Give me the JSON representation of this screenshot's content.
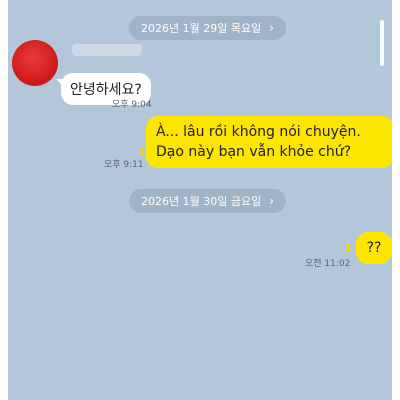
{
  "dates": {
    "first": "2026년 1월 29일 목요일",
    "second": "2026년 1월 30일 금요일",
    "chevron": "›"
  },
  "messages": [
    {
      "sender": "other",
      "text": "안녕하세요?",
      "time": "오후 9:04"
    },
    {
      "sender": "me",
      "text": "À... lâu rồi không nói chuyện. Dạo này bạn vẫn khỏe chứ?",
      "time": "오후 9:11",
      "unread": "1"
    },
    {
      "sender": "me",
      "text": "??",
      "time": "오전 11:02",
      "unread": "1"
    }
  ],
  "colors": {
    "chat_background": "#b2c7d9",
    "outgoing_bubble": "#fee500",
    "incoming_bubble": "#ffffff",
    "date_pill": "#9fb4c7",
    "unread_count": "#f5d90a"
  },
  "icons": {
    "date_chevron": "chevron-right-icon",
    "avatar": "profile-avatar"
  }
}
